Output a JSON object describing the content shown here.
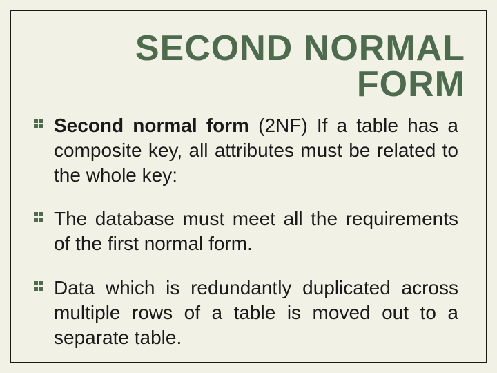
{
  "title": "SECOND NORMAL FORM",
  "bullets": [
    {
      "bold_lead": "Second normal form",
      "rest": " (2NF) If a table has a composite key, all attributes must be related to the whole key:"
    },
    {
      "bold_lead": "",
      "rest": "The database must meet all the requirements of the first normal form."
    },
    {
      "bold_lead": "",
      "rest": "Data which is redundantly duplicated across multiple rows of a table is moved out to a separate table."
    }
  ],
  "colors": {
    "background": "#f2f1e6",
    "title": "#4d6b4d",
    "bullet": "#4d6b4d",
    "text": "#1a1a1a",
    "border": "#1a1a1a"
  }
}
